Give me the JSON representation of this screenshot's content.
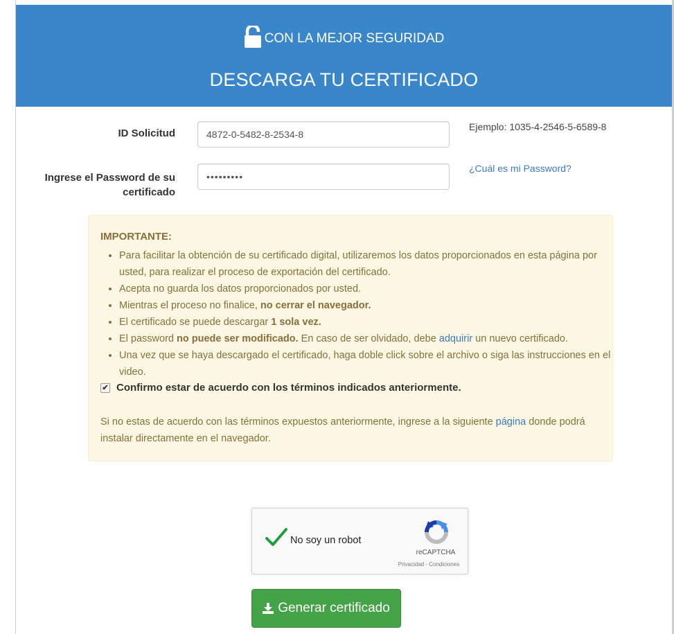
{
  "header": {
    "security_text": "CON LA MEJOR SEGURIDAD",
    "title": "DESCARGA TU CERTIFICADO",
    "background": "#3a86cb"
  },
  "form": {
    "id_label": "ID Solicitud",
    "id_value": "4872-0-5482-8-2534-8",
    "id_hint": "Ejemplo: 1035-4-2546-5-6589-8",
    "password_label_line1": "Ingrese el Password de su",
    "password_label_line2": "certificado",
    "password_value": "•••••••••",
    "password_help_link": "¿Cuál es mi Password?"
  },
  "notice": {
    "title": "IMPORTANTE:",
    "items": [
      {
        "text": "Para facilitar la obtención de su certificado digital, utilizaremos los datos proporcionados en esta página por usted, para realizar el proceso de exportación del certificado."
      },
      {
        "text": "Acepta no guarda los datos proporcionados por usted."
      },
      {
        "pre": "Mientras el proceso no finalice, ",
        "bold": "no cerrar el navegador."
      },
      {
        "pre": "El certificado se puede descargar ",
        "bold": "1 sola vez."
      },
      {
        "pre": "El password ",
        "bold": "no puede ser modificado.",
        "post": " En caso de ser olvidado, debe ",
        "link": "adquirir",
        "post2": " un nuevo certificado."
      },
      {
        "text": "Una vez que se haya descargado el certificado, haga doble click sobre el archivo o siga las instrucciones en el video."
      }
    ],
    "confirm_label": "Confirmo estar de acuerdo con los términos indicados anteriormente.",
    "confirm_checked": true,
    "footer_pre": "Si no estas de acuerdo con las términos expuestos anteriormente, ingrese a la siguiente ",
    "footer_link": "página",
    "footer_post": " donde podrá instalar directamente en el navegador.",
    "background": "#fcf8e3"
  },
  "captcha": {
    "label": "No soy un robot",
    "brand": "reCAPTCHA",
    "links": "Privacidad - Condiciones",
    "checked": true
  },
  "submit": {
    "label": "Generar certificado",
    "background": "#45a347"
  }
}
